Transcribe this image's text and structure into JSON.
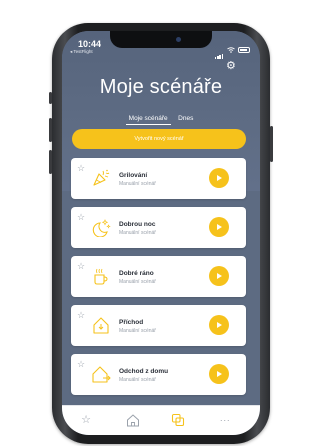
{
  "status_bar": {
    "time": "10:44",
    "back_app": "◂ TestFlight"
  },
  "header": {
    "title": "Moje scénáře",
    "settings_icon": "gear-icon"
  },
  "tabs": [
    {
      "label": "Moje scénáře",
      "active": true
    },
    {
      "label": "Dnes",
      "active": false
    }
  ],
  "create_button": {
    "label": "Vytvořit nový scénář"
  },
  "scenarios": [
    {
      "name": "Grilování",
      "type": "Manuální scénář",
      "icon": "party-popper-icon"
    },
    {
      "name": "Dobrou noc",
      "type": "Manuální scénář",
      "icon": "moon-stars-icon"
    },
    {
      "name": "Dobré ráno",
      "type": "Manuální scénář",
      "icon": "coffee-cup-icon"
    },
    {
      "name": "Příchod",
      "type": "Manuální scénář",
      "icon": "home-arrive-icon"
    },
    {
      "name": "Odchod z domu",
      "type": "Manuální scénář",
      "icon": "home-leave-icon"
    }
  ],
  "tab_bar": [
    {
      "icon": "star-icon",
      "active": false
    },
    {
      "icon": "home-icon",
      "active": false
    },
    {
      "icon": "scenarios-icon",
      "active": true
    },
    {
      "icon": "more-icon",
      "active": false
    }
  ],
  "colors": {
    "accent": "#f6c21b",
    "header_bg": "#5d6b82",
    "card_bg": "#ffffff"
  }
}
